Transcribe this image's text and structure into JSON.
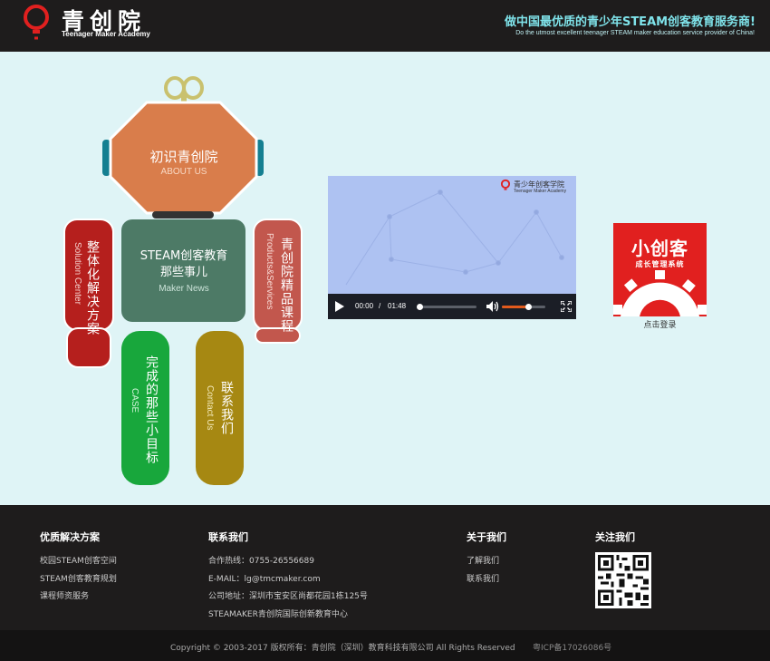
{
  "header": {
    "brand_name": "青创院",
    "brand_sub": "Teenager Maker Academy",
    "slogan_cn": "做中国最优质的青少年STEAM创客教育服务商!",
    "slogan_en": "Do the utmost excellent teenager STEAM maker education service provider of China!"
  },
  "robot": {
    "about": {
      "title": "初识青创院",
      "sub": "ABOUT US"
    },
    "news": {
      "title_line1": "STEAM创客教育",
      "title_line2": "那些事儿",
      "sub": "Maker News"
    },
    "solution": {
      "title": "整体化解决方案",
      "sub": "Solution Center"
    },
    "products": {
      "title": "青创院精品课程",
      "sub": "Products&Services"
    },
    "case": {
      "title": "完成的那些小目标",
      "sub": "CASE"
    },
    "contact": {
      "title": "联系我们",
      "sub": "Contact Us"
    }
  },
  "video": {
    "brand_cn": "青少年创客学院",
    "brand_en": "Teenager Maker Academy",
    "current_time": "00:00",
    "separator": "/",
    "duration": "01:48",
    "progress": 0,
    "volume": 0.6
  },
  "mini_app": {
    "title": "小创客",
    "subtitle": "成长管理系统",
    "login_label": "点击登录"
  },
  "footer": {
    "col1": {
      "heading": "优质解决方案",
      "items": [
        "校园STEAM创客空间",
        "STEAM创客教育规划",
        "课程师资服务"
      ]
    },
    "col2": {
      "heading": "联系我们",
      "items": [
        "合作热线：0755-26556689",
        "E-MAIL：lg@tmcmaker.com",
        "公司地址：深圳市宝安区尚都花园1栋125号",
        "STEAMAKER青创院国际创新教育中心"
      ]
    },
    "col3": {
      "heading": "关于我们",
      "items": [
        "了解我们",
        "联系我们"
      ]
    },
    "col4": {
      "heading": "关注我们"
    },
    "copyright": "Copyright © 2003-2017 版权所有：青创院（深圳）教育科技有限公司 All Rights Reserved",
    "icp": "粤ICP备17026086号"
  },
  "colors": {
    "page_bg": "#dff4f6",
    "header_bg": "#1e1c1c",
    "about": "#d97d4b",
    "news": "#4d7a66",
    "solution": "#b51f1d",
    "products": "#c2574d",
    "case": "#18a73c",
    "contact": "#a68812",
    "accent": "#e1201f"
  }
}
